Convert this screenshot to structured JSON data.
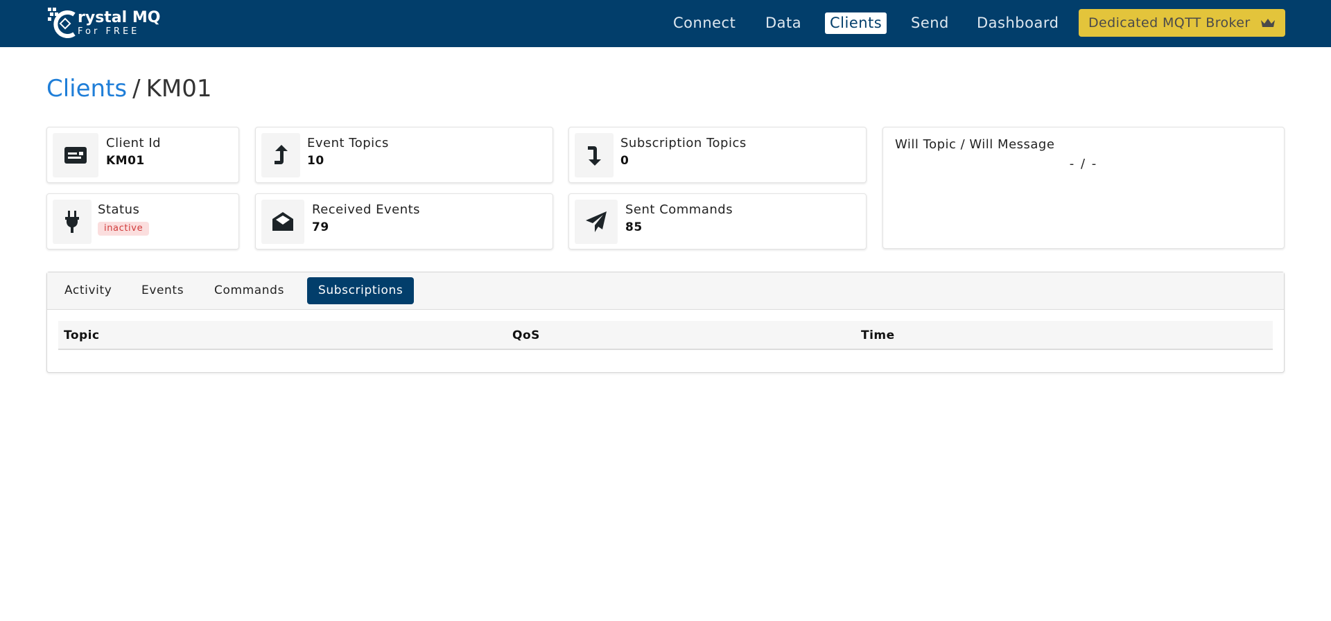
{
  "brand": {
    "title": "rystal MQ",
    "subtitle": "For FREE"
  },
  "nav": {
    "items": [
      {
        "label": "Connect"
      },
      {
        "label": "Data"
      },
      {
        "label": "Clients",
        "active": true
      },
      {
        "label": "Send"
      },
      {
        "label": "Dashboard"
      }
    ],
    "premium": {
      "label": "Dedicated MQTT Broker",
      "icon": "crown-icon",
      "color": "#e3c43b"
    }
  },
  "colors": {
    "header_bg": "#023e6b",
    "link": "#1f7ed8",
    "status_inactive_bg": "#fbdede",
    "status_inactive_text": "#d03b3b"
  },
  "breadcrumb": {
    "parent": "Clients",
    "separator": "/",
    "current": "KM01"
  },
  "stats": {
    "client_id": {
      "label": "Client Id",
      "value": "KM01",
      "icon": "id-card-icon"
    },
    "status": {
      "label": "Status",
      "value": "inactive",
      "icon": "plug-icon"
    },
    "event_topics": {
      "label": "Event Topics",
      "value": "10",
      "icon": "arrow-up-turn-icon"
    },
    "received_events": {
      "label": "Received Events",
      "value": "79",
      "icon": "envelope-open-icon"
    },
    "subscription_topics": {
      "label": "Subscription Topics",
      "value": "0",
      "icon": "arrow-down-turn-icon"
    },
    "sent_commands": {
      "label": "Sent Commands",
      "value": "85",
      "icon": "paper-plane-icon"
    },
    "will": {
      "label": "Will Topic / Will Message",
      "value": "- / -"
    }
  },
  "tabs": [
    {
      "label": "Activity"
    },
    {
      "label": "Events"
    },
    {
      "label": "Commands"
    },
    {
      "label": "Subscriptions",
      "active": true
    }
  ],
  "table": {
    "columns": [
      "Topic",
      "QoS",
      "Time"
    ],
    "rows": []
  }
}
